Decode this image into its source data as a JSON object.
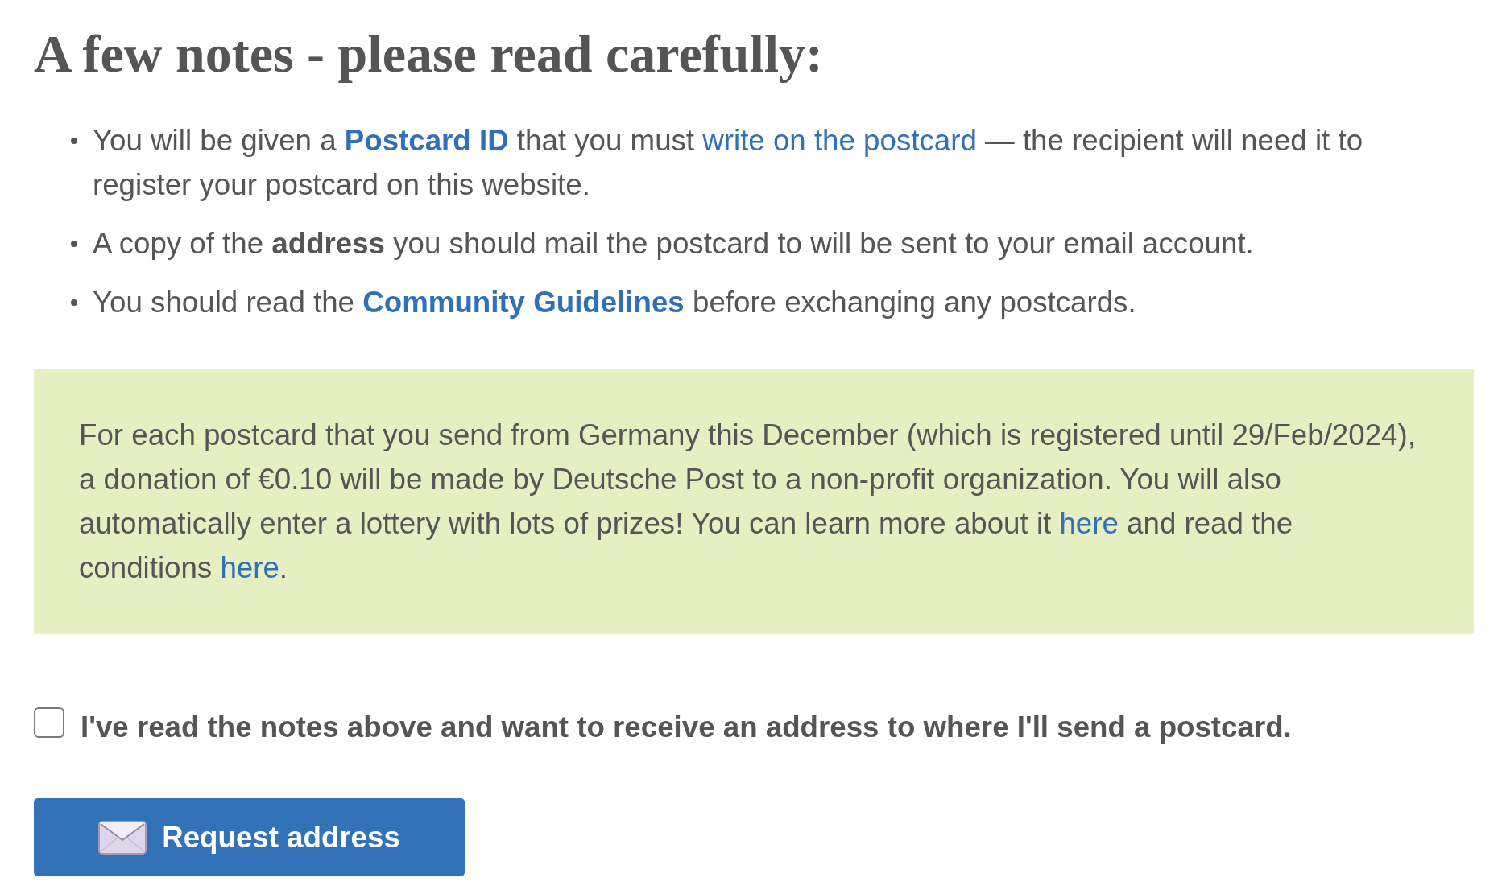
{
  "heading": "A few notes - please read carefully:",
  "notes": [
    {
      "parts": [
        {
          "kind": "text",
          "text": "You will be given a "
        },
        {
          "kind": "strong-link",
          "text": "Postcard ID"
        },
        {
          "kind": "text",
          "text": " that you must "
        },
        {
          "kind": "link",
          "text": "write on the postcard"
        },
        {
          "kind": "text",
          "text": " — the recipient will need it to register your postcard on this website."
        }
      ]
    },
    {
      "parts": [
        {
          "kind": "text",
          "text": "A copy of the **address** you should mail the postcard to will be sent to your email account."
        }
      ]
    },
    {
      "parts": [
        {
          "kind": "text",
          "text": "You should read the "
        },
        {
          "kind": "strong-link",
          "text": "Community Guidelines"
        },
        {
          "kind": "text",
          "text": " before exchanging any postcards."
        }
      ]
    }
  ],
  "notice": {
    "parts": [
      {
        "kind": "text",
        "text": "For each postcard that you send from Germany this December (which is registered until 29/Feb/2024), a donation of €0.10 will be made by Deutsche Post to a non-profit organization. You will also automatically enter a lottery with lots of prizes! You can learn more about it "
      },
      {
        "kind": "link",
        "text": "here"
      },
      {
        "kind": "text",
        "text": " and read the conditions "
      },
      {
        "kind": "link",
        "text": "here"
      },
      {
        "kind": "text",
        "text": "."
      }
    ]
  },
  "agreement": {
    "label": "I've read the notes above and want to receive an address to where I'll send a postcard.",
    "checked": false
  },
  "submit_button": {
    "label": "Request address"
  }
}
